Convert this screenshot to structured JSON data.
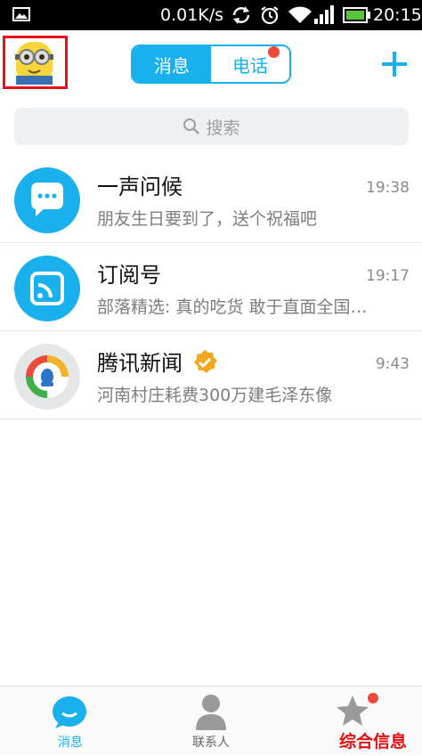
{
  "status_bar": {
    "speed": "0.01K/s",
    "time": "20:15",
    "battery_color": "#58c53a"
  },
  "header": {
    "tabs": [
      {
        "label": "消息",
        "active": true
      },
      {
        "label": "电话",
        "active": false,
        "has_badge": true
      }
    ],
    "accent_color": "#19b0ee",
    "add_icon": "plus-icon"
  },
  "search": {
    "placeholder": "搜索"
  },
  "conversations": [
    {
      "name": "一声问候",
      "time": "19:38",
      "preview": "朋友生日要到了，送个祝福吧",
      "icon": "chat-bubble-icon"
    },
    {
      "name": "订阅号",
      "time": "19:17",
      "preview": "部落精选: 真的吃货 敢于直面全国…",
      "icon": "rss-icon"
    },
    {
      "name": "腾讯新闻",
      "time": "9:43",
      "preview": "河南村庄耗费300万建毛泽东像",
      "icon": "tencent-news-icon",
      "verified": true
    }
  ],
  "bottom_nav": [
    {
      "label": "消息",
      "active": true,
      "icon": "message-icon"
    },
    {
      "label": "联系人",
      "active": false,
      "icon": "contacts-icon"
    },
    {
      "label": "",
      "active": false,
      "icon": "star-icon",
      "has_badge": true
    }
  ],
  "watermark": "综合信息"
}
